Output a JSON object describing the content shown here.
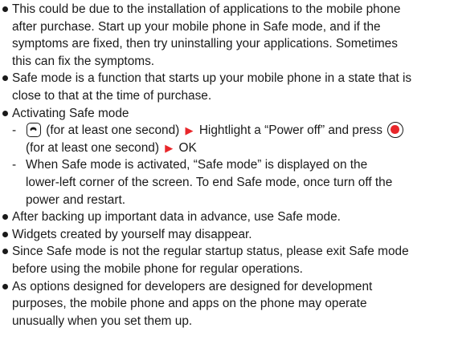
{
  "colors": {
    "text": "#1a1a1a",
    "accent": "#e8262a"
  },
  "icons": {
    "power_key": "power-key-icon",
    "center_key": "center-key-icon",
    "arrow": "right-triangle-icon",
    "arrow_glyph": "▶"
  },
  "bullets": [
    {
      "lines": [
        "This could be due to the installation of applications to the mobile phone",
        "after purchase. Start up your mobile phone in Safe mode, and if the",
        "symptoms are fixed, then try uninstalling your applications. Sometimes",
        "this can fix the symptoms."
      ]
    },
    {
      "lines": [
        "Safe mode is a function that starts up your mobile phone in a state that is",
        "close to that at the time of purchase."
      ]
    },
    {
      "lines": [
        "Activating Safe mode"
      ]
    }
  ],
  "activating": {
    "dash": "-",
    "step1_a": "(for at least one second)",
    "step1_b": "Hightlight a “Power off” and press",
    "step1_c": "(for at least one second)",
    "step1_d": "OK",
    "note_lines": [
      "When Safe mode is activated, “Safe mode” is displayed on the",
      "lower-left corner of the screen. To end Safe mode, once turn off the",
      "power and restart."
    ]
  },
  "bullets2": [
    {
      "lines": [
        "After backing up important data in advance, use Safe mode."
      ]
    },
    {
      "lines": [
        "Widgets created by yourself may disappear."
      ]
    },
    {
      "lines": [
        "Since Safe mode is not the regular startup status, please exit Safe mode",
        "before using the mobile phone for regular operations."
      ]
    },
    {
      "lines": [
        "As options designed for developers are designed for development",
        "purposes, the mobile phone and apps on the phone may operate",
        "unusually when you set them up."
      ]
    }
  ]
}
